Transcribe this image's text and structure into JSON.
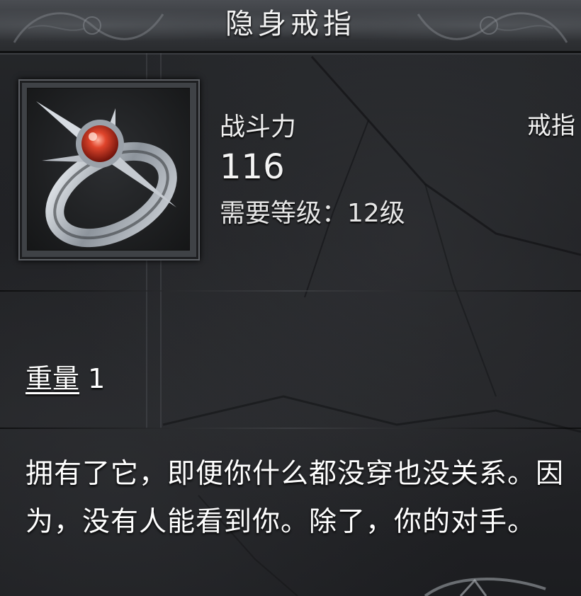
{
  "item": {
    "name": "隐身戒指",
    "slot": "戒指",
    "stat_label": "战斗力",
    "stat_value": "116",
    "level_requirement": "需要等级：12级",
    "weight_label": "重量",
    "weight_value": "1",
    "description": "拥有了它，即便你什么都没穿也没关系。因为，没有人能看到你。除了，你的对手。",
    "icon": "ring-with-red-gem-icon"
  },
  "colors": {
    "panel_background": "#1e1f22",
    "header_background": "#3a3c40",
    "text": "#f0f0f0",
    "gem": "#c8321e"
  }
}
